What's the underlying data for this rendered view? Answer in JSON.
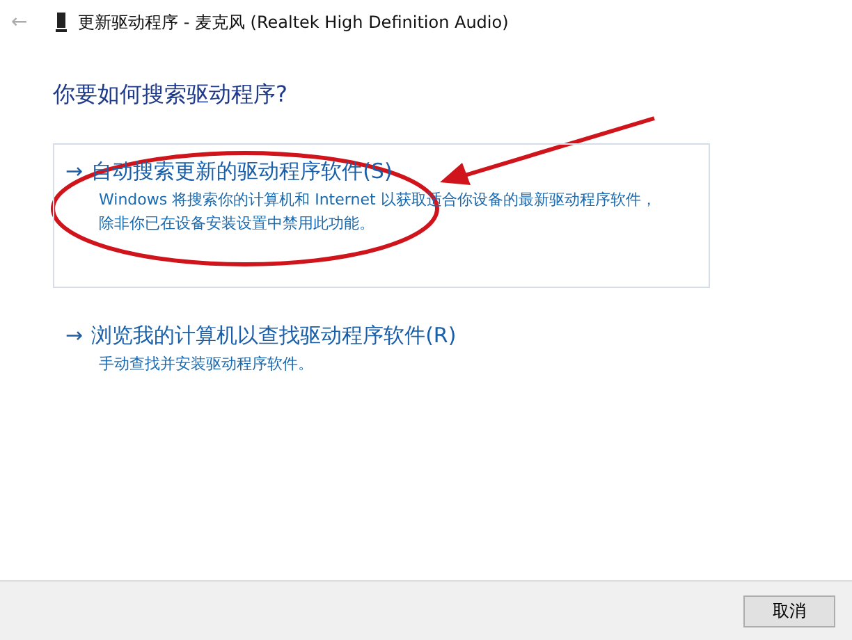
{
  "window": {
    "back": "←",
    "title": "更新驱动程序 - 麦克风 (Realtek High Definition Audio)"
  },
  "question": "你要如何搜索驱动程序?",
  "options": [
    {
      "arrow": "→",
      "title": "自动搜索更新的驱动程序软件(S)",
      "description": "Windows 将搜索你的计算机和 Internet 以获取适合你设备的最新驱动程序软件，除非你已在设备安装设置中禁用此功能。",
      "selected": true
    },
    {
      "arrow": "→",
      "title": "浏览我的计算机以查找驱动程序软件(R)",
      "description": "手动查找并安装驱动程序软件。",
      "selected": false
    }
  ],
  "buttons": [
    "取消"
  ]
}
